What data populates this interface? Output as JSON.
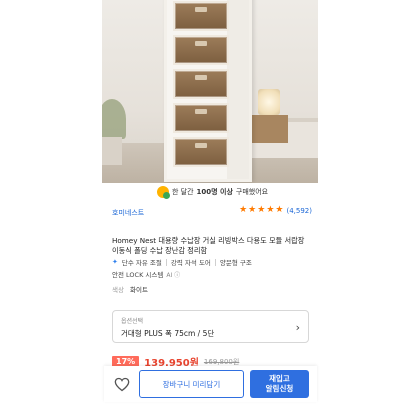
{
  "purchase_badge": {
    "icon": "award-icon",
    "prefix": "한 달간",
    "count": "100명 이상",
    "suffix": "구매했어요"
  },
  "seller": {
    "name": "호미네스트"
  },
  "rating": {
    "stars": 5,
    "count": "(4,592)",
    "color": "#ff7a00"
  },
  "product": {
    "title": "Homey Nest 대용량 수납장 거실 리빙박스 다용도 모듈 서랍장 이동식 폴딩 수납 장난감 정리함",
    "tags": [
      "단수 자유 조절",
      "강력 자석 도어",
      "양문형 구조"
    ],
    "tag_icon": "sparkle-icon",
    "lock_text": "안전 LOCK 시스템",
    "ai_mark": "AI ⓘ",
    "color_label": "색상",
    "color_value": "화이트"
  },
  "option": {
    "label": "옵션선택",
    "value": "거대형 PLUS 폭 75cm / 5단"
  },
  "price": {
    "discount": "17%",
    "sale": "139,950원",
    "original": "169,800원",
    "accent": "#e8442f"
  },
  "actions": {
    "cart": "장바구니 미리담기",
    "restock_line1": "재입고",
    "restock_line2": "알림신청",
    "brand_color": "#2f6fe0"
  }
}
